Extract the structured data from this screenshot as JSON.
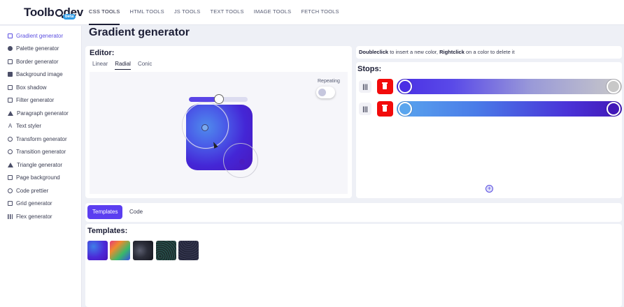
{
  "brand": {
    "logo_prefix": "Toolb",
    "logo_suffix": "dev",
    "badge": "beta"
  },
  "topnav": [
    "CSS TOOLS",
    "HTML TOOLS",
    "JS TOOLS",
    "TEXT TOOLS",
    "IMAGE TOOLS",
    "FETCH TOOLS"
  ],
  "sidebar": {
    "items": [
      {
        "label": "Gradient generator",
        "icon": "gradient-icon"
      },
      {
        "label": "Palette generator",
        "icon": "palette-icon"
      },
      {
        "label": "Border generator",
        "icon": "border-icon"
      },
      {
        "label": "Background image",
        "icon": "image-icon"
      },
      {
        "label": "Box shadow",
        "icon": "box-shadow-icon"
      },
      {
        "label": "Filter generator",
        "icon": "filter-icon"
      },
      {
        "label": "Paragraph generator",
        "icon": "paragraph-icon"
      },
      {
        "label": "Text styler",
        "icon": "text-icon"
      },
      {
        "label": "Transform generator",
        "icon": "transform-icon"
      },
      {
        "label": "Transition generator",
        "icon": "transition-icon"
      },
      {
        "label": "Triangle generator",
        "icon": "triangle-icon"
      },
      {
        "label": "Page background",
        "icon": "page-background-icon"
      },
      {
        "label": "Code prettier",
        "icon": "code-icon"
      },
      {
        "label": "Grid generator",
        "icon": "grid-icon"
      },
      {
        "label": "Flex generator",
        "icon": "flex-icon"
      }
    ]
  },
  "page": {
    "title": "Gradient generator"
  },
  "editor": {
    "title": "Editor:",
    "tabs": [
      "Linear",
      "Radial",
      "Conic"
    ],
    "active_tab": "Radial",
    "repeating_label": "Repeating",
    "repeating": false,
    "slider_value": 0.5
  },
  "hint": {
    "b1": "Doubleclick",
    "t1": " to insert a new color, ",
    "b2": "Rightclick",
    "t2": " on a color to delete it"
  },
  "stops": {
    "title": "Stops:",
    "drag_label": "|||",
    "rows": [
      {
        "color": "#4a2fe4",
        "end_color": "#c8c8c8"
      },
      {
        "color": "#5aa5ee",
        "end_color": "#4218b8"
      }
    ],
    "add_label": "+"
  },
  "bottom_tabs": [
    "Templates",
    "Code"
  ],
  "templates": {
    "title": "Templates:"
  },
  "colors": {
    "accent": "#5b3ef0",
    "delete": "#f20b0b"
  }
}
